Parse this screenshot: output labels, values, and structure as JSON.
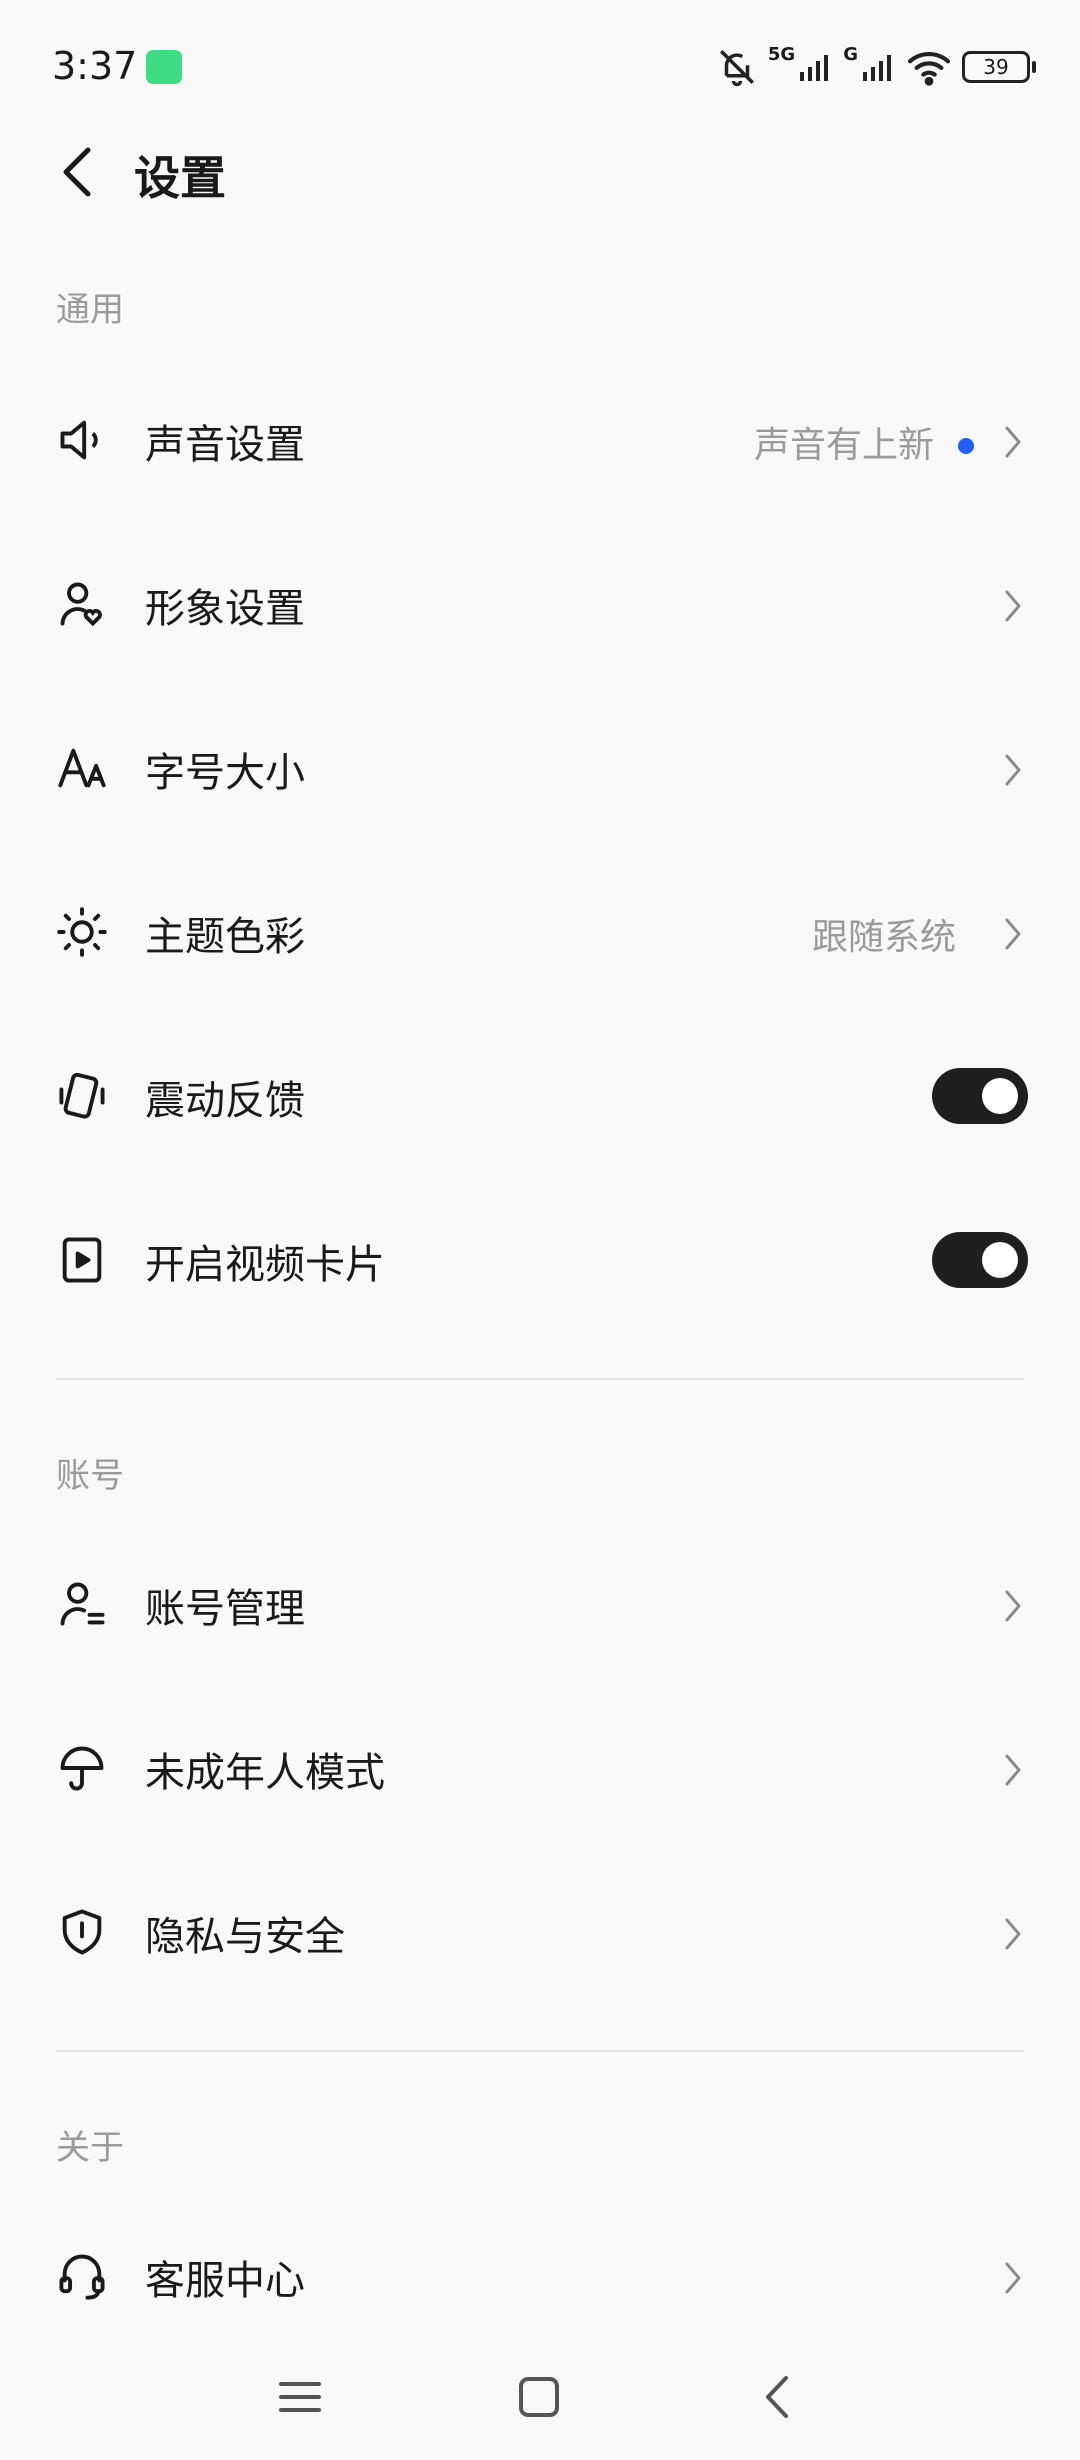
{
  "status_bar": {
    "time": "3:37",
    "signal_labels": [
      "5G",
      "G"
    ],
    "battery": "39",
    "icons": [
      "android-icon",
      "bell-muted-icon",
      "signal-icon",
      "wifi-icon",
      "battery-icon"
    ]
  },
  "header": {
    "title": "设置"
  },
  "sections": {
    "general": {
      "title": "通用"
    },
    "account": {
      "title": "账号"
    },
    "about": {
      "title": "关于"
    }
  },
  "rows": {
    "sound": {
      "label": "声音设置",
      "value": "声音有上新",
      "icon": "speaker-icon",
      "dot_color": "#1f5fff"
    },
    "avatar": {
      "label": "形象设置",
      "icon": "person-heart-icon"
    },
    "font": {
      "label": "字号大小",
      "icon": "font-size-icon"
    },
    "theme": {
      "label": "主题色彩",
      "value": "跟随系统",
      "icon": "sun-icon"
    },
    "vibration": {
      "label": "震动反馈",
      "icon": "vibrate-icon",
      "toggle_on": true
    },
    "video_card": {
      "label": "开启视频卡片",
      "icon": "video-card-icon",
      "toggle_on": true
    },
    "account_mgmt": {
      "label": "账号管理",
      "icon": "person-list-icon"
    },
    "minor_mode": {
      "label": "未成年人模式",
      "icon": "umbrella-icon"
    },
    "privacy": {
      "label": "隐私与安全",
      "icon": "shield-icon"
    },
    "support": {
      "label": "客服中心",
      "icon": "headset-icon"
    }
  },
  "nav": {
    "icons": [
      "menu-icon",
      "home-icon",
      "back-icon"
    ]
  }
}
